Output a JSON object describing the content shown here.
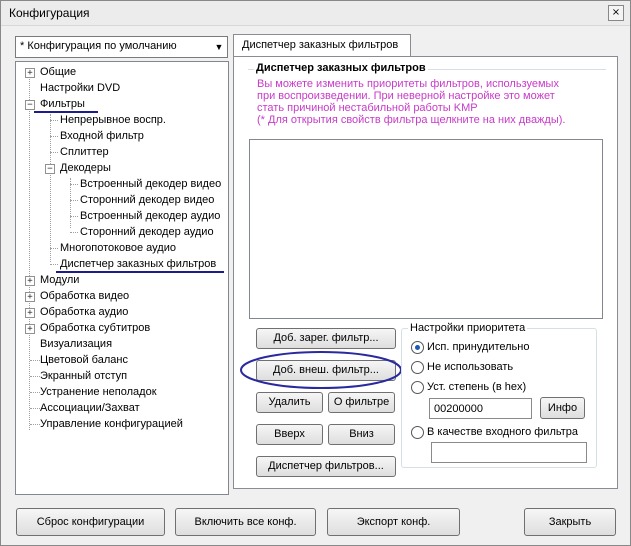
{
  "window": {
    "title": "Конфигурация",
    "close_glyph": "×"
  },
  "profile_select": {
    "value": "* Конфигурация по умолчанию"
  },
  "tree": {
    "general": "Общие",
    "dvd": "Настройки DVD",
    "filters": "Фильтры",
    "continuous": "Непрерывное воспр.",
    "input_filter": "Входной фильтр",
    "splitter": "Сплиттер",
    "decoders": "Декодеры",
    "builtin_video": "Встроенный декодер видео",
    "external_video": "Сторонний декодер видео",
    "builtin_audio": "Встроенный декодер аудио",
    "external_audio": "Сторонний декодер аудио",
    "multistream": "Многопотоковое аудио",
    "custom_filters": "Диспетчер заказных фильтров",
    "modules": "Модули",
    "video_proc": "Обработка видео",
    "audio_proc": "Обработка аудио",
    "subtitle_proc": "Обработка субтитров",
    "visualization": "Визуализация",
    "color_balance": "Цветовой баланс",
    "screen_margin": "Экранный отступ",
    "troubleshoot": "Устранение неполадок",
    "associations": "Ассоциации/Захват",
    "config_mgmt": "Управление конфигурацией",
    "expand_plus": "+",
    "expand_minus": "−"
  },
  "tab": {
    "label": "Диспетчер заказных фильтров"
  },
  "filters_group": {
    "legend": "Диспетчер заказных фильтров",
    "info_line1": "Вы можете изменить приоритеты фильтров, используемых",
    "info_line2": "при воспроизведении. При неверной настройке это может",
    "info_line3": "стать причиной нестабильной работы KMP",
    "info_line4": "(* Для открытия свойств фильтра щелкните на них дважды)."
  },
  "buttons": {
    "add_registered": "Доб. зарег. фильтр...",
    "add_external": "Доб. внеш. фильтр...",
    "delete": "Удалить",
    "about": "О фильтре",
    "up": "Вверх",
    "down": "Вниз",
    "filter_manager": "Диспетчер фильтров...",
    "info": "Инфо"
  },
  "priority": {
    "legend": "Настройки приоритета",
    "force": "Исп. принудительно",
    "dont_use": "Не использовать",
    "set_level": "Уст. степень (в hex)",
    "level_value": "00200000",
    "as_input": "В качестве входного фильтра",
    "input_value": ""
  },
  "footer": {
    "reset": "Сброс конфигурации",
    "enable_all": "Включить все конф.",
    "export": "Экспорт конф.",
    "close": "Закрыть"
  },
  "colors": {
    "info_text": "#c83ac8",
    "annotation": "#2a2aa0"
  }
}
